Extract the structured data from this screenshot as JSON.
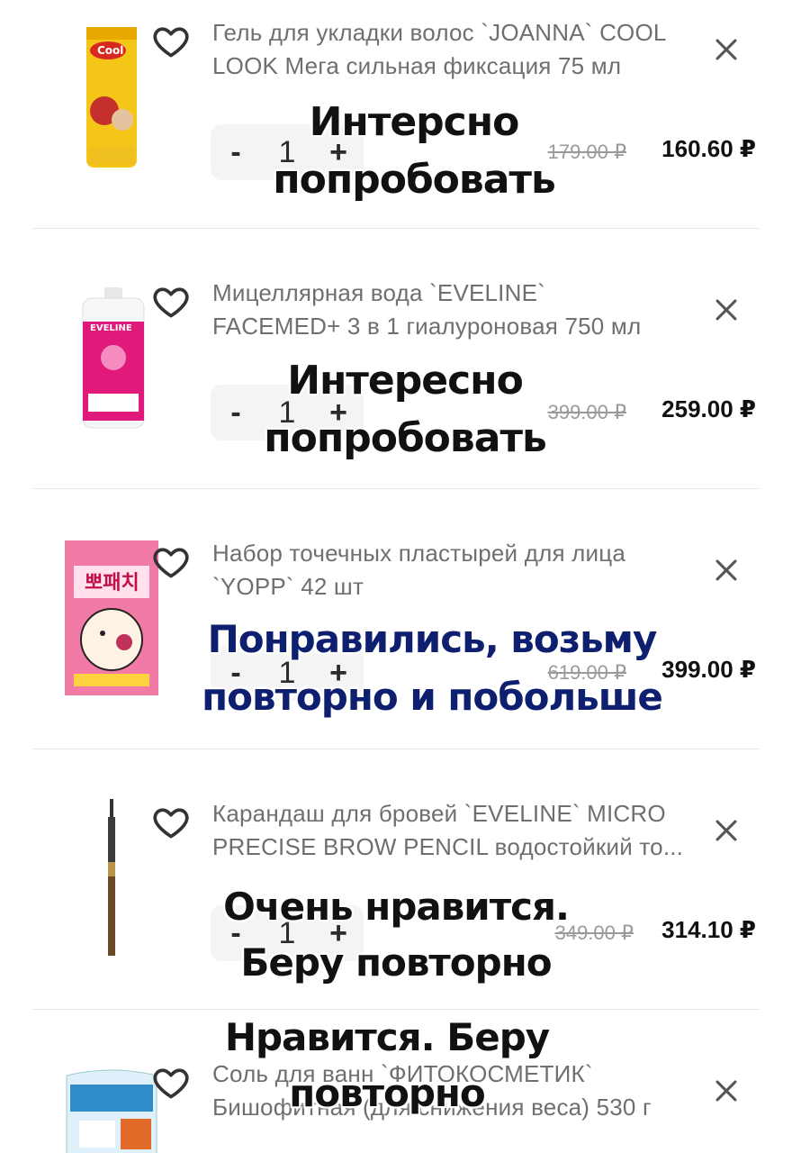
{
  "currency_note": "prices shown with ruble sign",
  "items": [
    {
      "title_line1": "Гель для укладки волос `JOANNA` COOL",
      "title_line2": "LOOK Мега сильная фиксация 75 мл",
      "quantity": "1",
      "old_price": "179.00 ₽",
      "new_price": "160.60 ₽",
      "note_line1": "Интерсно",
      "note_line2": "попробовать",
      "product_color": "#f2c41b"
    },
    {
      "title_line1": "Мицеллярная вода `EVELINE`",
      "title_line2": "FACEMED+ 3 в 1 гиалуроновая 750 мл",
      "quantity": "1",
      "old_price": "399.00 ₽",
      "new_price": "259.00 ₽",
      "note_line1": "Интересно",
      "note_line2": "попробовать",
      "product_color": "#e0197a"
    },
    {
      "title_line1": "Набор точечных пластырей для лица",
      "title_line2": "`YOPP` 42 шт",
      "quantity": "1",
      "old_price": "619.00 ₽",
      "new_price": "399.00 ₽",
      "note_line1": "Понравились, возьму",
      "note_line2": "повторно и побольше",
      "product_color": "#f27aa6"
    },
    {
      "title_line1": "Карандаш для бровей `EVELINE` MICRO",
      "title_line2": "PRECISE BROW PENCIL водостойкий то...",
      "quantity": "1",
      "old_price": "349.00 ₽",
      "new_price": "314.10 ₽",
      "note_line1": "Очень нравится.",
      "note_line2": "Беру повторно",
      "product_color": "#6b4a2a"
    },
    {
      "title_line1": "Соль для ванн `ФИТОКОСМЕТИК`",
      "title_line2": "Бишофитная (для снижения веса) 530 г",
      "note_line1": "Нравится. Беру",
      "note_line2": "повторно",
      "product_color": "#2f8bc9"
    }
  ],
  "qty_labels": {
    "minus": "-",
    "plus": "+"
  },
  "icons": {
    "favorite": "heart-outline-icon",
    "remove": "close-icon"
  }
}
